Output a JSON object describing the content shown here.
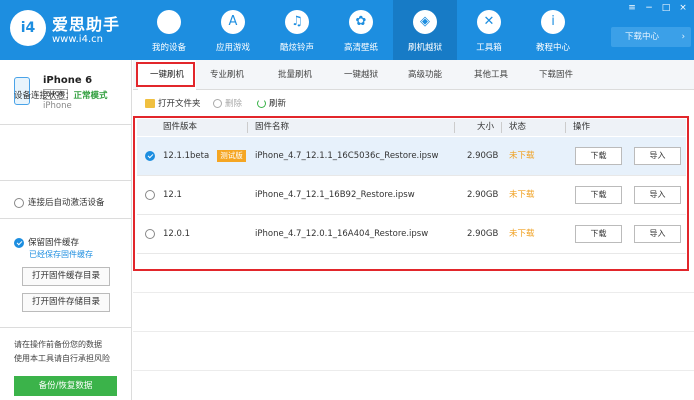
{
  "app": {
    "logo_text": "i4",
    "name": "爱思助手",
    "url": "www.i4.cn"
  },
  "nav": [
    {
      "label": "我的设备",
      "icon": "apple-icon",
      "glyph": ""
    },
    {
      "label": "应用游戏",
      "icon": "app-store-icon",
      "glyph": "A"
    },
    {
      "label": "酷炫铃声",
      "icon": "bell-icon",
      "glyph": "♫"
    },
    {
      "label": "高清壁纸",
      "icon": "flower-icon",
      "glyph": "✿"
    },
    {
      "label": "刷机越狱",
      "icon": "dropbox-icon",
      "glyph": "◈",
      "active": true
    },
    {
      "label": "工具箱",
      "icon": "tools-icon",
      "glyph": "✕"
    },
    {
      "label": "教程中心",
      "icon": "info-icon",
      "glyph": "i"
    }
  ],
  "window": {
    "minimize": "−",
    "maximize": "□",
    "close": "×",
    "settings": "≡"
  },
  "download_center": {
    "label": "下载中心",
    "chevron": "›"
  },
  "device": {
    "name": "iPhone 6",
    "capacity": "64GB",
    "model": "iPhone"
  },
  "sidebar": {
    "status_label": "设备连接状态：",
    "status_value": "正常模式",
    "auto_activate": "连接后自动激活设备",
    "keep_cache": "保留固件缓存",
    "cache_path": "已经保存固件缓存",
    "open_cache_dir": "打开固件缓存目录",
    "open_store_dir": "打开固件存储目录",
    "warning_line1": "请在操作前备份您的数据",
    "warning_line2": "使用本工具请自行承担风险",
    "backup_button": "备份/恢复数据"
  },
  "tabs": [
    "一键刷机",
    "专业刷机",
    "批量刷机",
    "一键越狱",
    "高级功能",
    "其他工具",
    "下载固件"
  ],
  "toolbar": {
    "open_folder": "打开文件夹",
    "delete": "删除",
    "refresh": "刷新"
  },
  "table": {
    "columns": {
      "version": "固件版本",
      "name": "固件名称",
      "size": "大小",
      "status": "状态",
      "action": "操作"
    },
    "rows": [
      {
        "version": "12.1.1beta",
        "badge": "测试版",
        "name": "iPhone_4.7_12.1.1_16C5036c_Restore.ipsw",
        "size": "2.90GB",
        "status": "未下载",
        "download": "下载",
        "import": "导入",
        "selected": true
      },
      {
        "version": "12.1",
        "name": "iPhone_4.7_12.1_16B92_Restore.ipsw",
        "size": "2.90GB",
        "status": "未下载",
        "download": "下载",
        "import": "导入"
      },
      {
        "version": "12.0.1",
        "name": "iPhone_4.7_12.0.1_16A404_Restore.ipsw",
        "size": "2.90GB",
        "status": "未下载",
        "download": "下载",
        "import": "导入"
      }
    ]
  }
}
